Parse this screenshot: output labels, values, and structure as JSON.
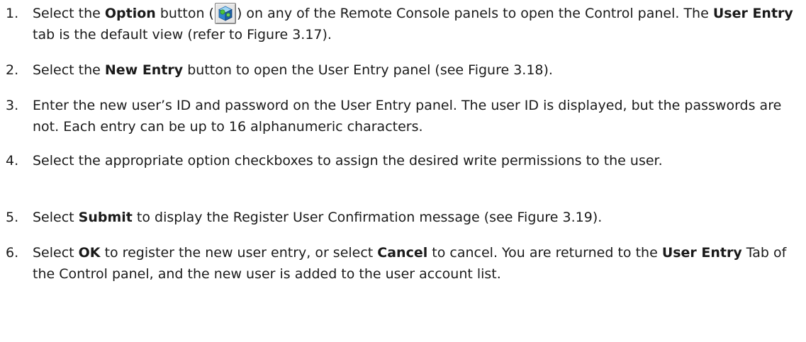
{
  "steps": [
    {
      "number": "1.",
      "parts": [
        {
          "t": "text",
          "v": "Select the "
        },
        {
          "t": "bold",
          "v": "Option"
        },
        {
          "t": "text",
          "v": " button ("
        },
        {
          "t": "icon",
          "icon": "option-cube-icon"
        },
        {
          "t": "text",
          "v": ") on any of the Remote Console panels to open the Control panel. The "
        },
        {
          "t": "bold",
          "v": "User Entry"
        },
        {
          "t": "text",
          "v": " tab is the default view (refer to Figure 3.17)."
        }
      ]
    },
    {
      "number": "2.",
      "parts": [
        {
          "t": "text",
          "v": "Select the "
        },
        {
          "t": "bold",
          "v": "New Entry"
        },
        {
          "t": "text",
          "v": " button to open the User Entry panel (see Figure 3.18)."
        }
      ]
    },
    {
      "number": "3.",
      "parts": [
        {
          "t": "text",
          "v": "Enter the new user’s ID and password on the User Entry panel. The user ID is displayed, but the passwords are not. Each entry can be up to 16 alphanumeric characters."
        }
      ]
    },
    {
      "number": "4.",
      "parts": [
        {
          "t": "text",
          "v": "Select the appropriate option checkboxes to assign the desired write permissions to the user."
        }
      ]
    },
    {
      "number": "5.",
      "parts": [
        {
          "t": "text",
          "v": "Select "
        },
        {
          "t": "bold",
          "v": "Submit"
        },
        {
          "t": "text",
          "v": " to display the Register User Confirmation message (see Figure 3.19)."
        }
      ]
    },
    {
      "number": "6.",
      "parts": [
        {
          "t": "text",
          "v": "Select "
        },
        {
          "t": "bold",
          "v": "OK"
        },
        {
          "t": "text",
          "v": " to register the new user entry, or select "
        },
        {
          "t": "bold",
          "v": "Cancel"
        },
        {
          "t": "text",
          "v": " to cancel. You are returned to the "
        },
        {
          "t": "bold",
          "v": "User Entry"
        },
        {
          "t": "text",
          "v": " Tab of the Control panel, and the new user is added to the user account list."
        }
      ]
    }
  ]
}
